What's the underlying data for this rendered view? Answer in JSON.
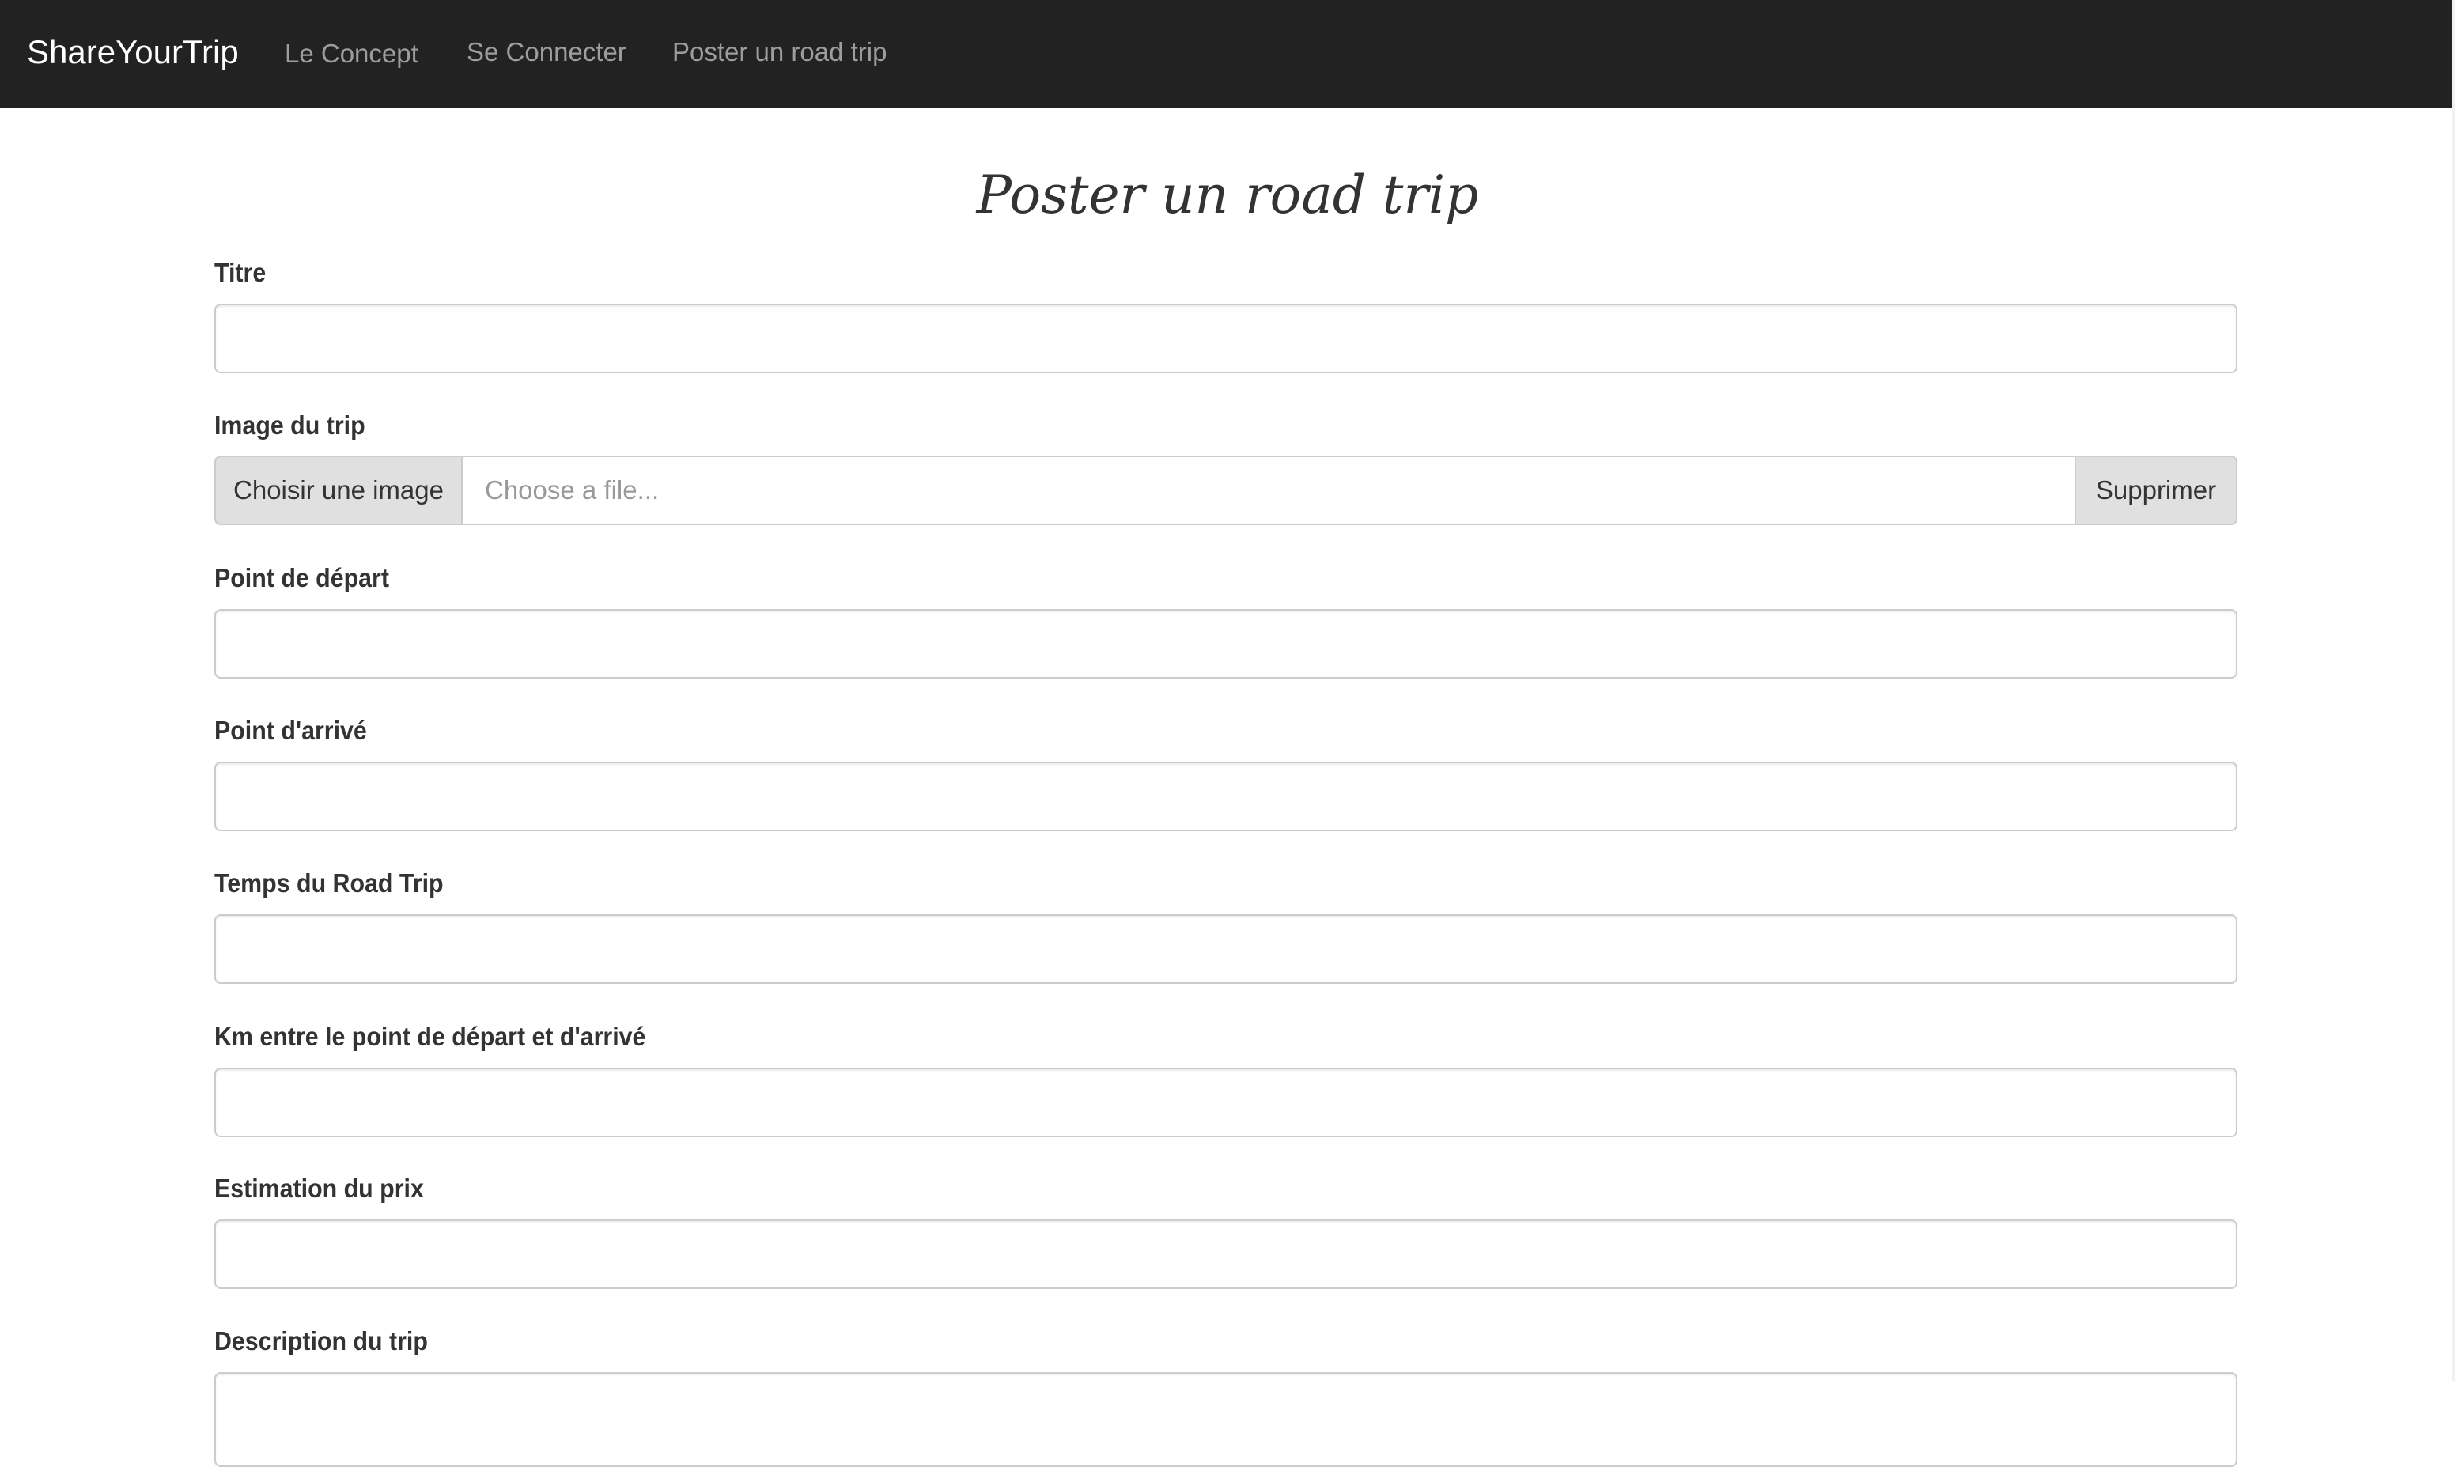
{
  "navbar": {
    "brand": "ShareYourTrip",
    "links": [
      "Le Concept",
      "Se Connecter",
      "Poster un road trip"
    ]
  },
  "page": {
    "title": "Poster un road trip"
  },
  "form": {
    "titre_label": "Titre",
    "titre_value": "",
    "image_label": "Image du trip",
    "image_choose": "Choisir une image",
    "image_placeholder": "Choose a file...",
    "image_remove": "Supprimer",
    "depart_label": "Point de départ",
    "depart_value": "",
    "arrivee_label": "Point d'arrivé",
    "arrivee_value": "",
    "temps_label": "Temps du Road Trip",
    "temps_value": "",
    "km_label": "Km entre le point de départ et d'arrivé",
    "km_value": "",
    "prix_label": "Estimation du prix",
    "prix_value": "",
    "description_label": "Description du trip",
    "description_value": ""
  },
  "colors": {
    "navbar_bg": "#222222",
    "nav_link": "#9d9d9d",
    "brand": "#ffffff",
    "input_border": "#cccccc",
    "addon_bg": "#e0e0e0"
  }
}
